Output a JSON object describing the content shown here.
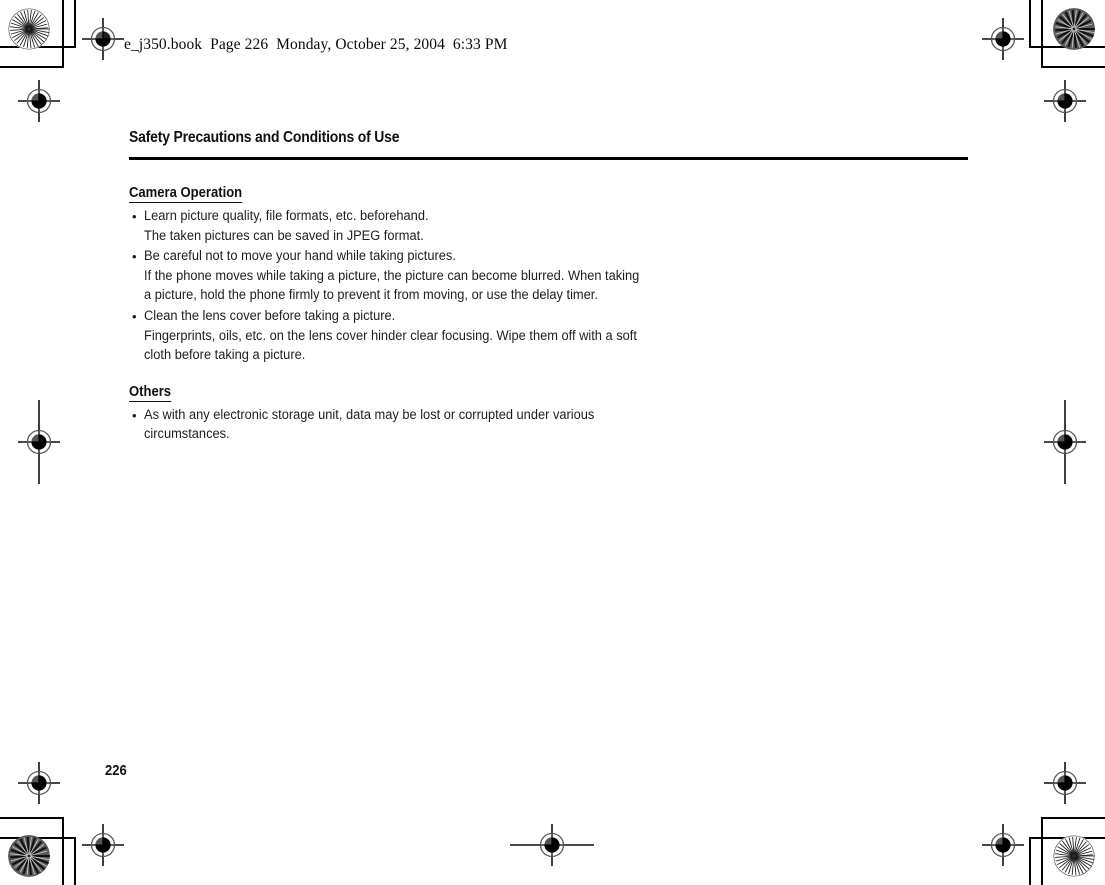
{
  "document": {
    "header_line": "e_j350.book  Page 226  Monday, October 25, 2004  6:33 PM",
    "chapter_title": "Safety Precautions and Conditions of Use",
    "folio": "226",
    "sections": [
      {
        "heading": "Camera Operation",
        "items": [
          {
            "bullet": "Learn picture quality, file formats, etc. beforehand.",
            "continuation": [
              "The taken pictures can be saved in JPEG format."
            ]
          },
          {
            "bullet": "Be careful not to move your hand while taking pictures.",
            "continuation": [
              "If the phone moves while taking a picture, the picture can become blurred. When taking",
              "a picture, hold the phone firmly to prevent it from moving, or use the delay timer."
            ]
          },
          {
            "bullet": "Clean the lens cover before taking a picture.",
            "continuation": [
              "Fingerprints, oils, etc. on the lens cover hinder clear focusing. Wipe them off with a soft",
              "cloth before taking a picture."
            ]
          }
        ]
      },
      {
        "heading": "Others",
        "items": [
          {
            "bullet": "As with any electronic storage unit, data may be lost or corrupted under various",
            "continuation": [
              "circumstances."
            ]
          }
        ]
      }
    ]
  },
  "print_marks": {
    "registration_mark_label": "registration-mark",
    "star_target_label": "star-density-target",
    "trim_line_label": "trim-line",
    "ink_color": "#000000"
  }
}
